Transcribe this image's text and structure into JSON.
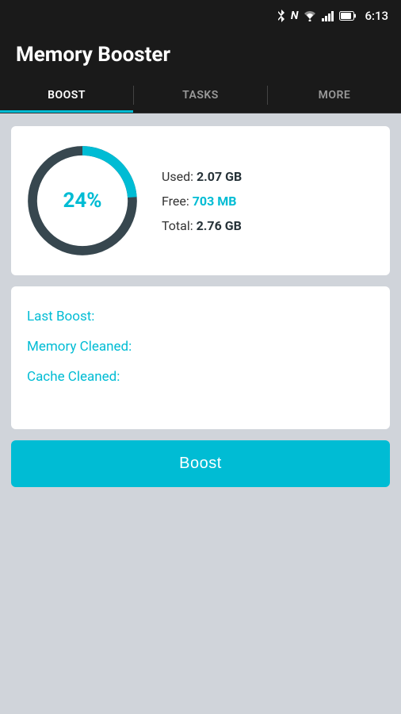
{
  "status_bar": {
    "battery": "81%",
    "time": "6:13"
  },
  "header": {
    "title": "Memory Booster"
  },
  "tabs": [
    {
      "id": "boost",
      "label": "BOOST",
      "active": true
    },
    {
      "id": "tasks",
      "label": "TASKS",
      "active": false
    },
    {
      "id": "more",
      "label": "MORE",
      "active": false
    }
  ],
  "memory": {
    "percent": "24%",
    "used_label": "Used:",
    "used_value": "2.07 GB",
    "free_label": "Free:",
    "free_value": "703 MB",
    "total_label": "Total:",
    "total_value": "2.76 GB"
  },
  "info": {
    "last_boost_label": "Last Boost:",
    "memory_cleaned_label": "Memory Cleaned:",
    "cache_cleaned_label": "Cache Cleaned:"
  },
  "boost_button": {
    "label": "Boost"
  },
  "colors": {
    "accent": "#00bcd4",
    "dark_track": "#37474f",
    "bg": "#d0d4da"
  }
}
